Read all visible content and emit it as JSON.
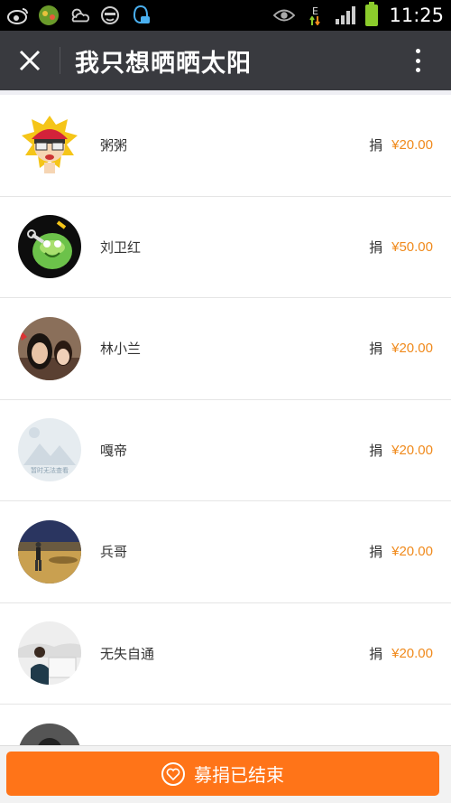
{
  "status": {
    "time": "11:25",
    "network": "E"
  },
  "header": {
    "title": "我只想晒晒太阳"
  },
  "donations": [
    {
      "name": "粥粥",
      "label": "捐",
      "amount": "¥20.00"
    },
    {
      "name": "刘卫红",
      "label": "捐",
      "amount": "¥50.00"
    },
    {
      "name": "林小兰",
      "label": "捐",
      "amount": "¥20.00"
    },
    {
      "name": "嘎帝",
      "label": "捐",
      "amount": "¥20.00"
    },
    {
      "name": "兵哥",
      "label": "捐",
      "amount": "¥20.00"
    },
    {
      "name": "无失自通",
      "label": "捐",
      "amount": "¥20.00"
    }
  ],
  "placeholder_avatar_text": "暂时无法查看",
  "bottom": {
    "button_label": "募捐已结束"
  },
  "colors": {
    "accent": "#ff7418",
    "amount": "#f08a1c",
    "header": "#393a3f"
  }
}
